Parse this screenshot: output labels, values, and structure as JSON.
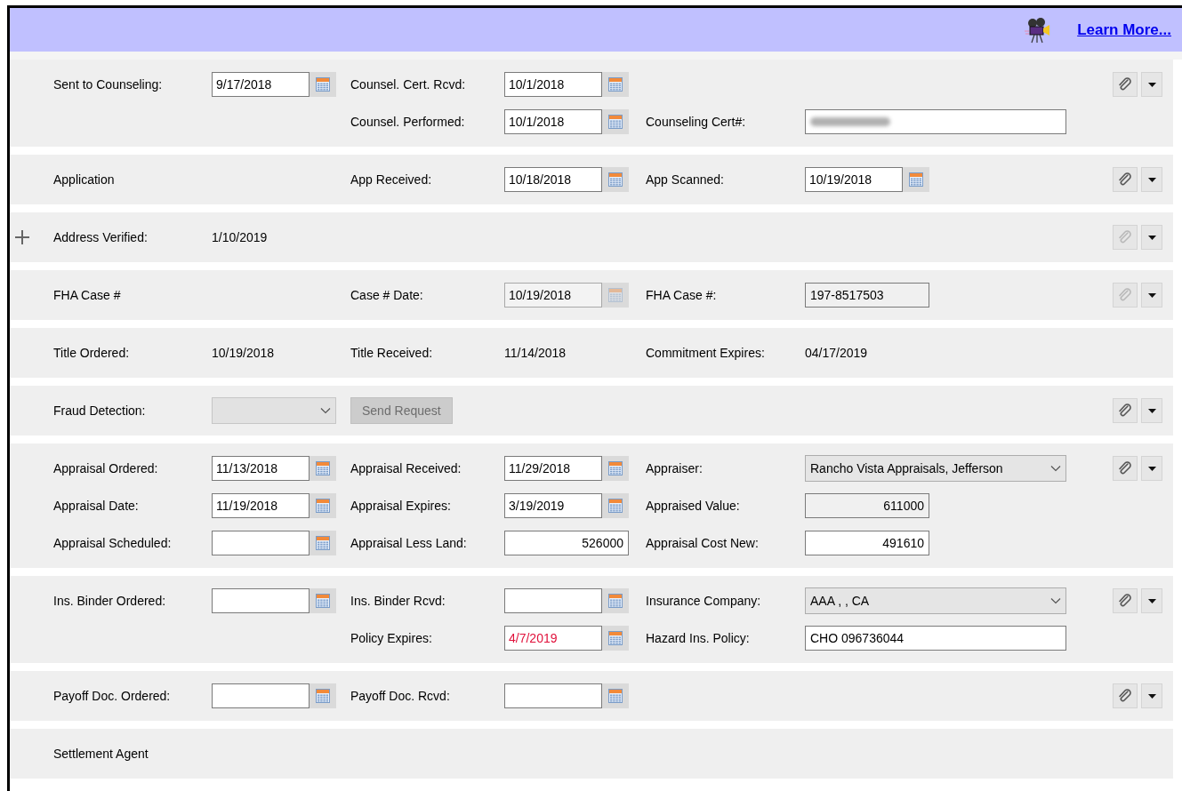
{
  "header": {
    "link": "Learn More..."
  },
  "sections": [
    {
      "attach": {
        "enabled": true
      },
      "rows": [
        [
          {
            "kind": "label",
            "text": "Sent to Counseling:"
          },
          {
            "kind": "date",
            "value": "9/17/2018",
            "disabled": false,
            "expired": false
          },
          {
            "kind": "label",
            "text": "Counsel. Cert. Rcvd:"
          },
          {
            "kind": "date",
            "value": "10/1/2018",
            "disabled": false,
            "expired": false
          },
          null,
          null
        ],
        [
          null,
          null,
          {
            "kind": "label",
            "text": "Counsel. Performed:"
          },
          {
            "kind": "date",
            "value": "10/1/2018",
            "disabled": false,
            "expired": false
          },
          {
            "kind": "label",
            "text": "Counseling Cert#:"
          },
          {
            "kind": "redacted",
            "wide": true
          }
        ]
      ]
    },
    {
      "attach": {
        "enabled": true
      },
      "rows": [
        [
          {
            "kind": "label",
            "text": "Application"
          },
          null,
          {
            "kind": "label",
            "text": "App Received:"
          },
          {
            "kind": "date",
            "value": "10/18/2018",
            "disabled": false,
            "expired": false
          },
          {
            "kind": "label",
            "text": "App Scanned:"
          },
          {
            "kind": "date",
            "value": "10/19/2018",
            "disabled": false,
            "expired": false
          }
        ]
      ]
    },
    {
      "expanded": false,
      "attach": {
        "enabled": false
      },
      "rows": [
        [
          {
            "kind": "label",
            "text": "Address Verified:"
          },
          {
            "kind": "value",
            "text": "1/10/2019"
          },
          null,
          null,
          null,
          null
        ]
      ]
    },
    {
      "attach": {
        "enabled": false
      },
      "rows": [
        [
          {
            "kind": "label",
            "text": "FHA Case #"
          },
          null,
          {
            "kind": "label",
            "text": "Case # Date:"
          },
          {
            "kind": "date",
            "value": "10/19/2018",
            "disabled": true,
            "expired": false
          },
          {
            "kind": "label",
            "text": "FHA Case #:"
          },
          {
            "kind": "text",
            "value": "197-8517503",
            "wide": false,
            "readonly": true
          }
        ]
      ]
    },
    {
      "rows": [
        [
          {
            "kind": "label",
            "text": "Title Ordered:"
          },
          {
            "kind": "value",
            "text": "10/19/2018"
          },
          {
            "kind": "label",
            "text": "Title Received:"
          },
          {
            "kind": "value",
            "text": "11/14/2018"
          },
          {
            "kind": "label",
            "text": "Commitment Expires:"
          },
          {
            "kind": "value",
            "text": "04/17/2019"
          }
        ]
      ]
    },
    {
      "attach": {
        "enabled": true
      },
      "rows": [
        [
          {
            "kind": "label",
            "text": "Fraud Detection:"
          },
          {
            "kind": "combo",
            "disabled": true,
            "wide": false
          },
          {
            "kind": "button",
            "label": "Send Request",
            "disabled": true
          },
          null,
          null,
          null
        ]
      ]
    },
    {
      "attach": {
        "enabled": true
      },
      "rows": [
        [
          {
            "kind": "label",
            "text": "Appraisal Ordered:"
          },
          {
            "kind": "date",
            "value": "11/13/2018",
            "disabled": false,
            "expired": false
          },
          {
            "kind": "label",
            "text": "Appraisal Received:"
          },
          {
            "kind": "date",
            "value": "11/29/2018",
            "disabled": false,
            "expired": false
          },
          {
            "kind": "label",
            "text": "Appraiser:"
          },
          {
            "kind": "combo",
            "value": "Rancho Vista Appraisals, Jefferson",
            "disabled": false,
            "wide": true
          }
        ],
        [
          {
            "kind": "label",
            "text": "Appraisal Date:"
          },
          {
            "kind": "date",
            "value": "11/19/2018",
            "disabled": false,
            "expired": false
          },
          {
            "kind": "label",
            "text": "Appraisal Expires:"
          },
          {
            "kind": "date",
            "value": "3/19/2019",
            "disabled": false,
            "expired": false
          },
          {
            "kind": "label",
            "text": "Appraised Value:"
          },
          {
            "kind": "number",
            "value": "611000",
            "wide": false,
            "readonly": true
          }
        ],
        [
          {
            "kind": "label",
            "text": "Appraisal Scheduled:"
          },
          {
            "kind": "date",
            "disabled": false
          },
          {
            "kind": "label",
            "text": "Appraisal Less Land:"
          },
          {
            "kind": "number",
            "value": "526000",
            "wide": false,
            "readonly": false
          },
          {
            "kind": "label",
            "text": "Appraisal Cost New:"
          },
          {
            "kind": "number",
            "value": "491610",
            "wide": false,
            "readonly": false
          }
        ]
      ]
    },
    {
      "attach": {
        "enabled": true
      },
      "rows": [
        [
          {
            "kind": "label",
            "text": "Ins. Binder Ordered:"
          },
          {
            "kind": "date",
            "disabled": false
          },
          {
            "kind": "label",
            "text": "Ins. Binder Rcvd:"
          },
          {
            "kind": "date",
            "disabled": false
          },
          {
            "kind": "label",
            "text": "Insurance Company:"
          },
          {
            "kind": "combo",
            "value": "AAA ,  , CA",
            "disabled": false,
            "wide": true
          }
        ],
        [
          null,
          null,
          {
            "kind": "label",
            "text": "Policy Expires:"
          },
          {
            "kind": "date",
            "value": "4/7/2019",
            "disabled": false,
            "expired": true
          },
          {
            "kind": "label",
            "text": "Hazard Ins. Policy:"
          },
          {
            "kind": "text",
            "value": "CHO 096736044",
            "wide": true,
            "readonly": false
          }
        ]
      ]
    },
    {
      "attach": {
        "enabled": true
      },
      "rows": [
        [
          {
            "kind": "label",
            "text": "Payoff Doc. Ordered:"
          },
          {
            "kind": "date",
            "disabled": false
          },
          {
            "kind": "label",
            "text": "Payoff Doc. Rcvd:"
          },
          {
            "kind": "date",
            "disabled": false
          },
          null,
          null
        ]
      ]
    },
    {
      "rows": [
        [
          {
            "kind": "label",
            "text": "Settlement Agent"
          },
          null,
          null,
          null,
          null,
          null
        ]
      ]
    }
  ]
}
